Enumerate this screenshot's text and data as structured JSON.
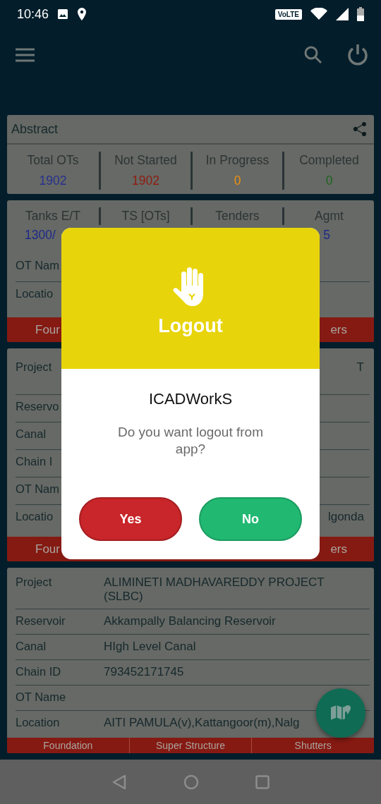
{
  "status_bar": {
    "time": "10:46",
    "network_badge": "VoLTE"
  },
  "cards": [
    {
      "kind": "abstract",
      "title": "Abstract",
      "stats": [
        {
          "label": "Total OTs",
          "value": "1902",
          "color": "#27308f"
        },
        {
          "label": "Not Started",
          "value": "1902",
          "color": "#8f1c12"
        },
        {
          "label": "In Progress",
          "value": "0",
          "color": "#f2920f"
        },
        {
          "label": "Completed",
          "value": "0",
          "color": "#1d6420"
        }
      ]
    },
    {
      "kind": "covered_stats",
      "stats": [
        "Tanks E/T",
        "TS [OTs]",
        "Tenders",
        "Agmt"
      ],
      "values": [
        "1300/",
        "5"
      ],
      "rows": [
        {
          "label": "OT Nam"
        },
        {
          "label": "Locatio"
        }
      ],
      "tabs": [
        "Four",
        "ers"
      ]
    },
    {
      "kind": "covered_details",
      "rows": [
        {
          "label": "Project",
          "value": "T"
        },
        {
          "label": "Reservo"
        },
        {
          "label": "Canal"
        },
        {
          "label": "Chain I"
        },
        {
          "label": "OT Nam"
        },
        {
          "label": "Locatio",
          "value": "lgonda"
        }
      ],
      "tabs": [
        "Four",
        "ers"
      ]
    },
    {
      "kind": "details",
      "rows": [
        {
          "label": "Project",
          "value": "ALIMINETI MADHAVAREDDY PROJECT (SLBC)"
        },
        {
          "label": "Reservoir",
          "value": "Akkampally Balancing Reservoir"
        },
        {
          "label": "Canal",
          "value": "HIgh Level Canal"
        },
        {
          "label": "Chain ID",
          "value": "793452171745"
        },
        {
          "label": "OT Name"
        },
        {
          "label": "Location",
          "value": "AITI PAMULA(v),Kattangoor(m),Nalg"
        }
      ],
      "tabs": [
        "Foundation",
        "Super Structure",
        "Shutters"
      ]
    }
  ],
  "dialog": {
    "title": "Logout",
    "app_name": "ICADWorkS",
    "message": "Do you want logout from app?",
    "buttons": [
      {
        "label": "Yes",
        "kind": "confirm"
      },
      {
        "label": "No",
        "kind": "cancel"
      }
    ]
  }
}
